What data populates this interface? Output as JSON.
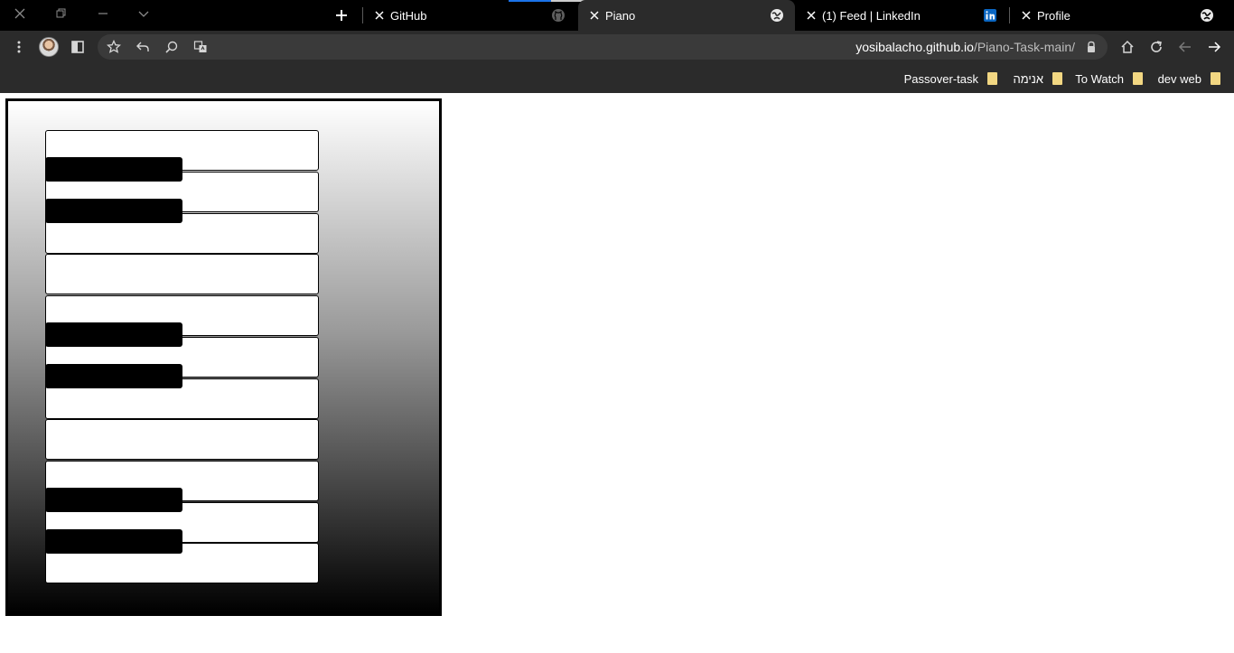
{
  "window_controls": [
    "close",
    "restore",
    "minimize",
    "dropdown"
  ],
  "tabs": [
    {
      "title": "GitHub",
      "favicon": "github-icon",
      "active": false
    },
    {
      "title": "Piano",
      "favicon": "globe-icon",
      "active": true
    },
    {
      "title": "(1) Feed | LinkedIn",
      "favicon": "linkedin-icon",
      "active": false
    },
    {
      "title": "Profile",
      "favicon": "globe-icon",
      "active": false
    }
  ],
  "new_tab_label": "+",
  "address_bar": {
    "host": "yosibalacho.github.io",
    "path": "/Piano-Task-main/"
  },
  "bookmarks": [
    {
      "label": "Passover-task"
    },
    {
      "label": "אנימה"
    },
    {
      "label": "To Watch"
    },
    {
      "label": "dev web"
    }
  ],
  "piano": {
    "white_keys": 11,
    "black_keys": 6
  },
  "colors": {
    "tab_bg": "#000000",
    "toolbar_bg": "#2b2b2b",
    "linkedin_blue": "#0a66c2",
    "bookmark_folder": "#f2d782"
  }
}
